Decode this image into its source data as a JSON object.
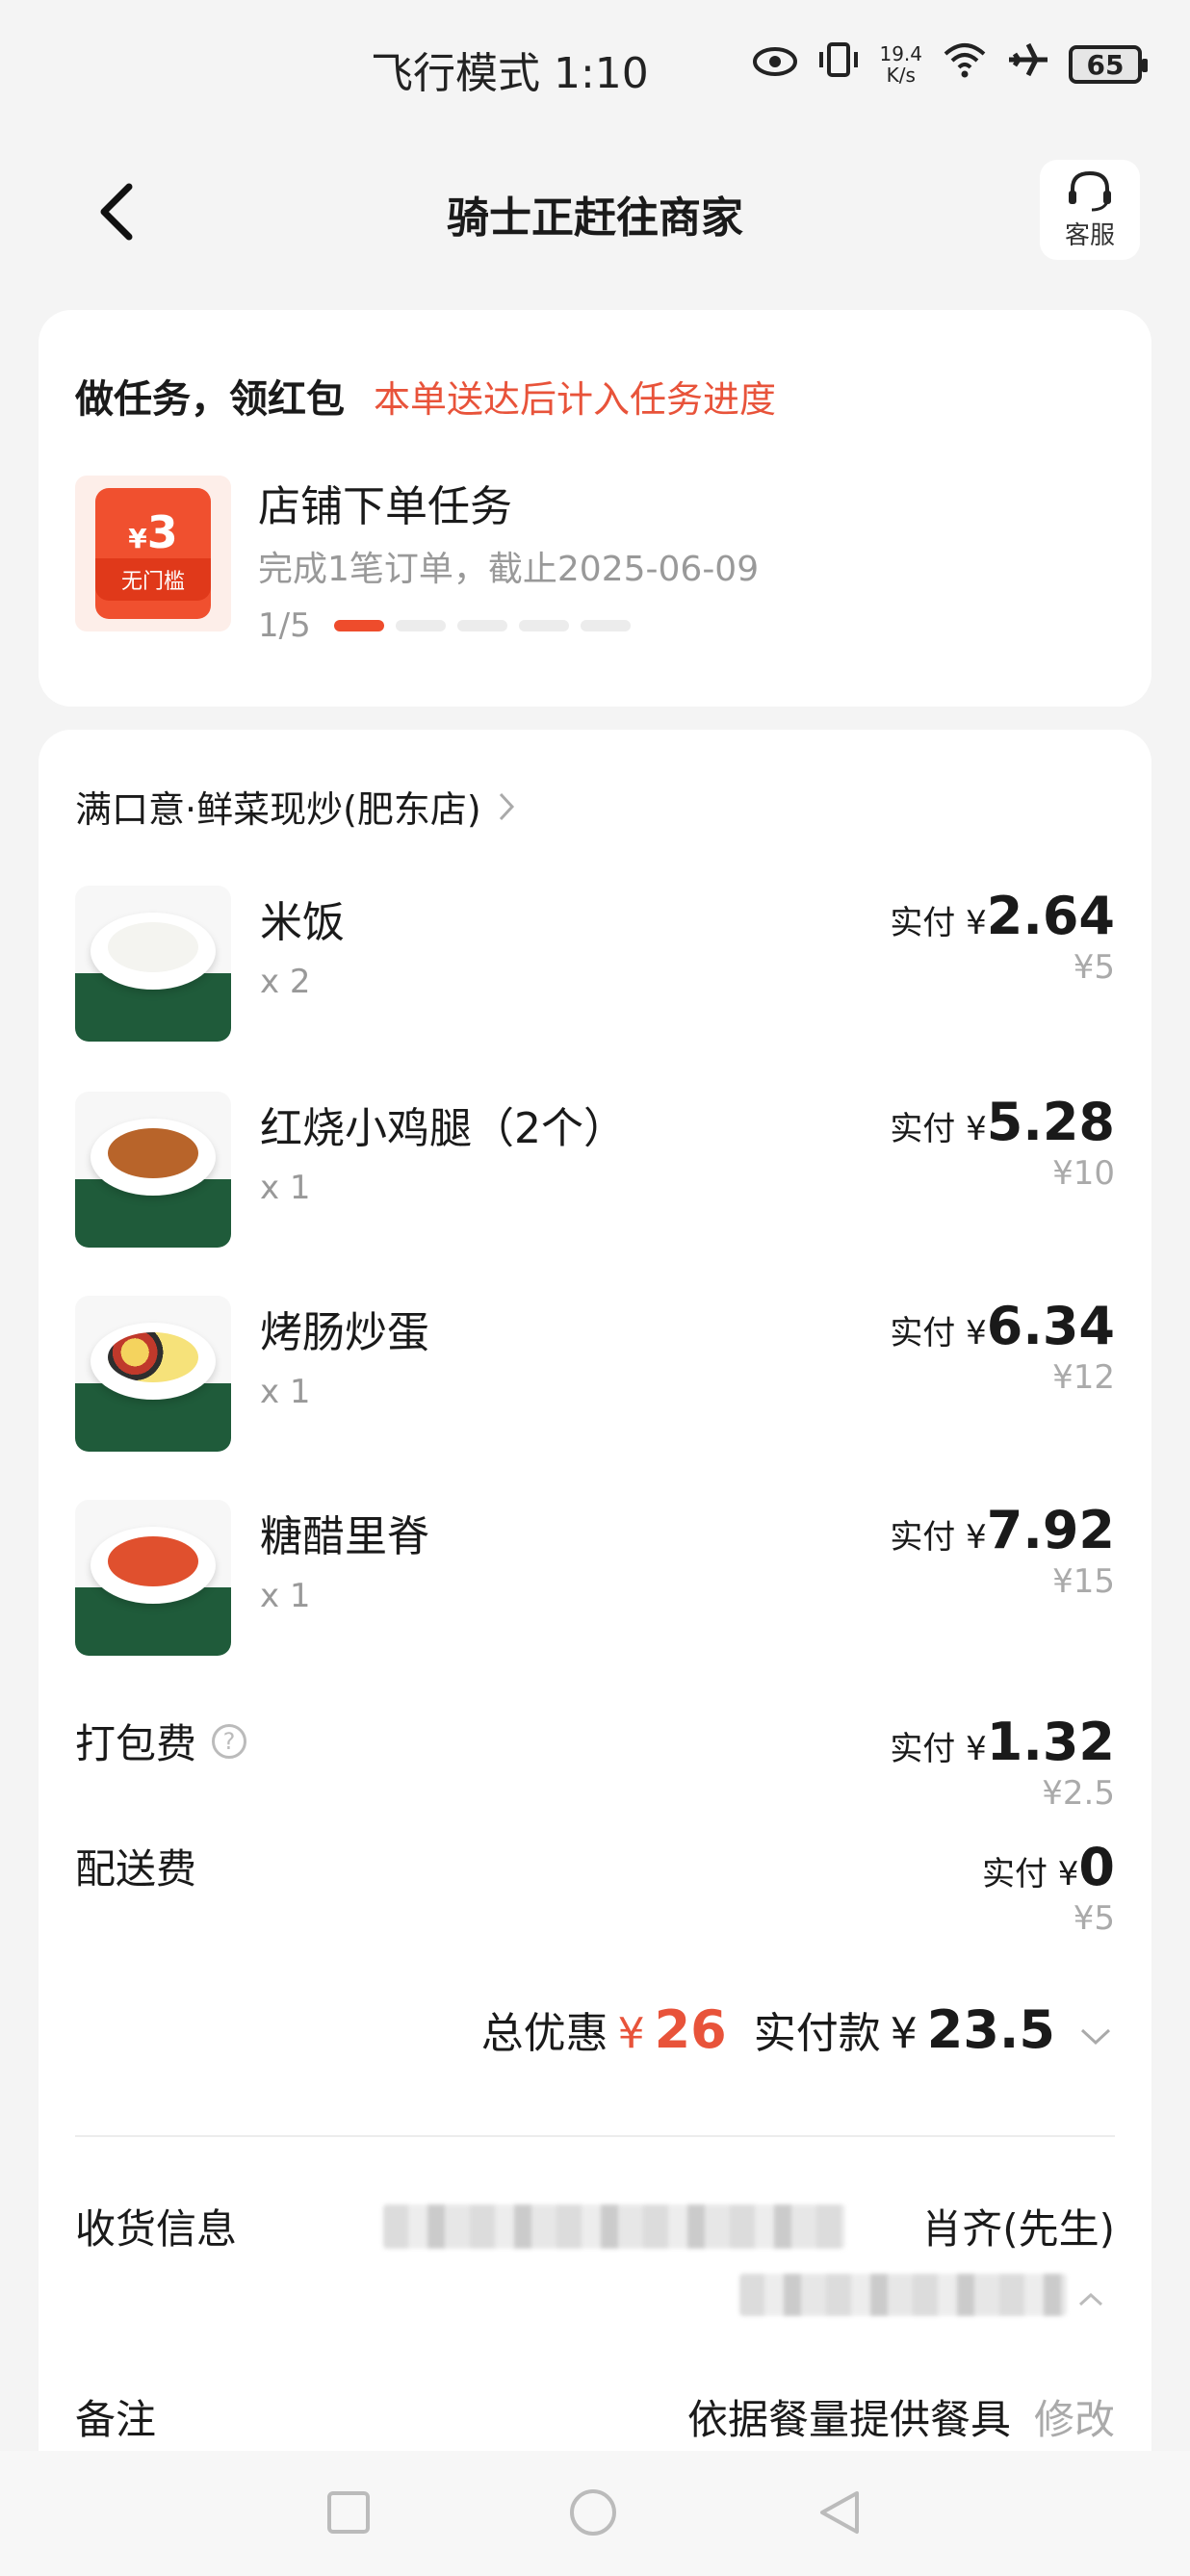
{
  "status_bar": {
    "time": "飞行模式 1:10",
    "net_speed_value": "19.4",
    "net_speed_unit": "K/s",
    "battery": "65"
  },
  "header": {
    "title": "骑士正赶往商家",
    "service_label": "客服"
  },
  "task": {
    "title": "做任务，领红包",
    "subtitle": "本单送达后计入任务进度",
    "coupon_amount": "3",
    "coupon_currency": "¥",
    "coupon_tag": "无门槛",
    "name": "店铺下单任务",
    "desc": "完成1笔订单，截止2025-06-09",
    "progress": "1/5",
    "progress_done": 1,
    "progress_total": 5
  },
  "order": {
    "store_name": "满口意·鲜菜现炒(肥东店)",
    "paid_prefix": "实付",
    "currency": "¥",
    "items": [
      {
        "name": "米饭",
        "qty": "x 2",
        "paid": "2.64",
        "original": "¥5"
      },
      {
        "name": "红烧小鸡腿（2个）",
        "qty": "x 1",
        "paid": "5.28",
        "original": "¥10"
      },
      {
        "name": "烤肠炒蛋",
        "qty": "x 1",
        "paid": "6.34",
        "original": "¥12"
      },
      {
        "name": "糖醋里脊",
        "qty": "x 1",
        "paid": "7.92",
        "original": "¥15"
      }
    ],
    "packing_fee": {
      "label": "打包费",
      "paid": "1.32",
      "original": "¥2.5"
    },
    "delivery_fee": {
      "label": "配送费",
      "paid": "0",
      "original": "¥5"
    },
    "total_discount_label": "总优惠",
    "total_discount": "26",
    "total_paid_label": "实付款",
    "total_paid": "23.5"
  },
  "delivery_info": {
    "label": "收货信息",
    "recipient_tail": "肖齐(先生)"
  },
  "remark": {
    "label": "备注",
    "value": "依据餐量提供餐具",
    "edit_label": "修改"
  },
  "colors": {
    "accent": "#e8533a",
    "background": "#f4f4f4",
    "card": "#ffffff"
  }
}
